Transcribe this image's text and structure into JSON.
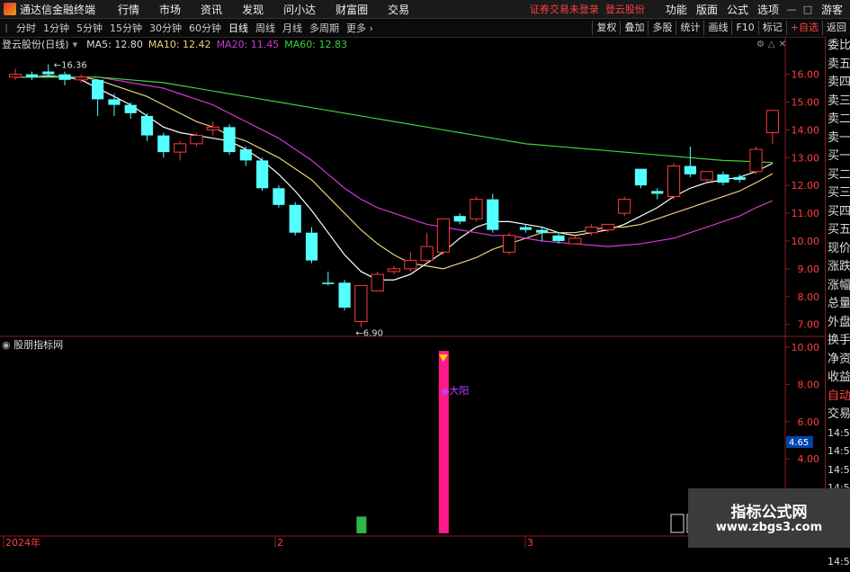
{
  "app": {
    "name": "通达信金融终端"
  },
  "menu": [
    "行情",
    "市场",
    "资讯",
    "发现",
    "问小达",
    "财富圈",
    "交易"
  ],
  "warning": "证券交易未登录",
  "warning_stock": "登云股份",
  "right_menu": [
    "功能",
    "版面",
    "公式",
    "选项"
  ],
  "guest": "游客",
  "periods": [
    "分时",
    "1分钟",
    "5分钟",
    "15分钟",
    "30分钟",
    "60分钟",
    "日线",
    "周线",
    "月线",
    "多周期",
    "更多"
  ],
  "active_period": "日线",
  "tools": [
    "复权",
    "叠加",
    "多股",
    "统计",
    "画线",
    "F10",
    "标记",
    "+自选",
    "返回"
  ],
  "chart_header": {
    "stock": "登云股份(日线)",
    "ma5": "MA5: 12.80",
    "ma10": "MA10: 12.42",
    "ma20": "MA20: 11.45",
    "ma60": "MA60: 12.83"
  },
  "price_axis": [
    "16.00",
    "15.00",
    "14.00",
    "13.00",
    "12.00",
    "11.00",
    "10.00",
    "9.00",
    "8.00",
    "7.00"
  ],
  "high_label": "16.36",
  "low_label": "6.90",
  "lower_panel": {
    "title": "股朋指标网",
    "axis": [
      "10.00",
      "8.00",
      "6.00",
      "4.00",
      "2.00"
    ],
    "marker_label": "大阳",
    "current_value": "4.65"
  },
  "date_axis": [
    "2024年",
    "2",
    "3"
  ],
  "right_panel": {
    "labels": [
      "委比",
      "卖五",
      "卖四",
      "卖三",
      "卖二",
      "卖一",
      "买一",
      "买二",
      "买三",
      "买四",
      "买五",
      "现价",
      "涨跌",
      "涨幅",
      "总量",
      "外盘",
      "换手",
      "净资",
      "收益",
      "自动",
      "交易"
    ],
    "times": [
      "14:55",
      "14:56",
      "14:56",
      "14:56",
      "14:56",
      "14:56",
      "14:56",
      "14:56"
    ]
  },
  "watermark": {
    "title": "指标公式网",
    "url": "www.zbgs3.com"
  },
  "colors": {
    "up": "#ff3a3a",
    "down": "#54ffff",
    "ma5": "#ffffff",
    "ma10": "#e8d27a",
    "ma20": "#d23ad2",
    "ma60": "#3ad23a",
    "marker": "#ff1a8c"
  },
  "chart_data": {
    "type": "candlestick",
    "candles": [
      {
        "o": 15.9,
        "c": 16.0,
        "h": 16.2,
        "l": 15.8
      },
      {
        "o": 16.0,
        "c": 15.9,
        "h": 16.1,
        "l": 15.8
      },
      {
        "o": 16.1,
        "c": 16.0,
        "h": 16.36,
        "l": 15.9
      },
      {
        "o": 16.0,
        "c": 15.8,
        "h": 16.1,
        "l": 15.6
      },
      {
        "o": 15.8,
        "c": 15.9,
        "h": 16.0,
        "l": 15.7
      },
      {
        "o": 15.8,
        "c": 15.1,
        "h": 15.8,
        "l": 14.5
      },
      {
        "o": 15.1,
        "c": 14.9,
        "h": 15.3,
        "l": 14.5
      },
      {
        "o": 14.9,
        "c": 14.6,
        "h": 15.0,
        "l": 14.4
      },
      {
        "o": 14.5,
        "c": 13.8,
        "h": 14.6,
        "l": 13.6
      },
      {
        "o": 13.8,
        "c": 13.2,
        "h": 13.9,
        "l": 13.0
      },
      {
        "o": 13.2,
        "c": 13.5,
        "h": 13.6,
        "l": 12.9
      },
      {
        "o": 13.5,
        "c": 13.8,
        "h": 13.9,
        "l": 13.4
      },
      {
        "o": 14.0,
        "c": 14.1,
        "h": 14.3,
        "l": 13.8
      },
      {
        "o": 14.1,
        "c": 13.2,
        "h": 14.2,
        "l": 13.1
      },
      {
        "o": 13.3,
        "c": 12.9,
        "h": 13.4,
        "l": 12.7
      },
      {
        "o": 12.9,
        "c": 11.9,
        "h": 13.0,
        "l": 11.8
      },
      {
        "o": 11.9,
        "c": 11.3,
        "h": 12.0,
        "l": 11.2
      },
      {
        "o": 11.3,
        "c": 10.3,
        "h": 11.4,
        "l": 10.2
      },
      {
        "o": 10.3,
        "c": 9.3,
        "h": 10.5,
        "l": 9.2
      },
      {
        "o": 8.5,
        "c": 8.45,
        "h": 8.9,
        "l": 8.4
      },
      {
        "o": 8.5,
        "c": 7.6,
        "h": 8.6,
        "l": 7.5
      },
      {
        "o": 7.1,
        "c": 8.4,
        "h": 8.4,
        "l": 6.9
      },
      {
        "o": 8.2,
        "c": 8.8,
        "h": 8.9,
        "l": 8.2
      },
      {
        "o": 8.9,
        "c": 9.0,
        "h": 9.1,
        "l": 8.8
      },
      {
        "o": 9.0,
        "c": 9.3,
        "h": 9.6,
        "l": 8.9
      },
      {
        "o": 9.3,
        "c": 9.8,
        "h": 10.3,
        "l": 9.2
      },
      {
        "o": 9.6,
        "c": 10.8,
        "h": 10.8,
        "l": 9.5
      },
      {
        "o": 10.9,
        "c": 10.7,
        "h": 11.0,
        "l": 10.6
      },
      {
        "o": 10.8,
        "c": 11.5,
        "h": 11.6,
        "l": 10.7
      },
      {
        "o": 11.5,
        "c": 10.4,
        "h": 11.7,
        "l": 10.3
      },
      {
        "o": 9.6,
        "c": 10.2,
        "h": 10.3,
        "l": 9.5
      },
      {
        "o": 10.5,
        "c": 10.4,
        "h": 10.6,
        "l": 10.3
      },
      {
        "o": 10.4,
        "c": 10.3,
        "h": 10.5,
        "l": 10.0
      },
      {
        "o": 10.2,
        "c": 10.0,
        "h": 10.3,
        "l": 9.9
      },
      {
        "o": 9.9,
        "c": 10.1,
        "h": 10.2,
        "l": 9.9
      },
      {
        "o": 10.3,
        "c": 10.5,
        "h": 10.6,
        "l": 10.2
      },
      {
        "o": 10.4,
        "c": 10.6,
        "h": 10.6,
        "l": 10.3
      },
      {
        "o": 11.0,
        "c": 11.5,
        "h": 11.6,
        "l": 10.9
      },
      {
        "o": 12.6,
        "c": 12.0,
        "h": 12.6,
        "l": 11.9
      },
      {
        "o": 11.8,
        "c": 11.7,
        "h": 11.9,
        "l": 11.5
      },
      {
        "o": 11.6,
        "c": 12.7,
        "h": 12.8,
        "l": 11.5
      },
      {
        "o": 12.7,
        "c": 12.4,
        "h": 13.4,
        "l": 12.3
      },
      {
        "o": 12.2,
        "c": 12.5,
        "h": 12.5,
        "l": 12.1
      },
      {
        "o": 12.4,
        "c": 12.1,
        "h": 12.5,
        "l": 12.0
      },
      {
        "o": 12.3,
        "c": 12.2,
        "h": 12.4,
        "l": 12.1
      },
      {
        "o": 12.5,
        "c": 13.3,
        "h": 13.4,
        "l": 12.4
      },
      {
        "o": 13.9,
        "c": 14.7,
        "h": 14.7,
        "l": 13.5
      }
    ],
    "ma_lines": [
      {
        "name": "MA5",
        "values": [
          15.9,
          15.9,
          15.95,
          15.9,
          15.8,
          15.5,
          15.2,
          14.9,
          14.5,
          14.1,
          13.9,
          13.8,
          13.7,
          13.6,
          13.3,
          12.9,
          12.4,
          11.8,
          11.1,
          10.3,
          9.5,
          8.9,
          8.6,
          8.6,
          8.8,
          9.2,
          9.6,
          10.1,
          10.5,
          10.7,
          10.7,
          10.6,
          10.5,
          10.3,
          10.2,
          10.3,
          10.4,
          10.6,
          10.9,
          11.2,
          11.6,
          11.9,
          12.1,
          12.2,
          12.3,
          12.5,
          12.8
        ]
      },
      {
        "name": "MA10",
        "values": [
          15.9,
          15.9,
          15.9,
          15.9,
          15.9,
          15.8,
          15.6,
          15.4,
          15.2,
          14.9,
          14.6,
          14.3,
          14.1,
          13.8,
          13.6,
          13.3,
          13.0,
          12.6,
          12.2,
          11.6,
          11.0,
          10.4,
          9.9,
          9.5,
          9.2,
          9.1,
          9.0,
          9.2,
          9.4,
          9.7,
          9.9,
          10.1,
          10.3,
          10.3,
          10.3,
          10.4,
          10.5,
          10.5,
          10.6,
          10.8,
          11.0,
          11.2,
          11.4,
          11.6,
          11.8,
          12.1,
          12.42
        ]
      },
      {
        "name": "MA20",
        "values": [
          15.9,
          15.9,
          15.9,
          15.9,
          15.9,
          15.9,
          15.8,
          15.7,
          15.6,
          15.5,
          15.3,
          15.1,
          14.9,
          14.6,
          14.3,
          14.0,
          13.7,
          13.3,
          12.9,
          12.4,
          11.9,
          11.5,
          11.2,
          11.0,
          10.8,
          10.6,
          10.5,
          10.4,
          10.3,
          10.2,
          10.2,
          10.1,
          10.0,
          9.95,
          9.9,
          9.85,
          9.8,
          9.85,
          9.9,
          10.0,
          10.1,
          10.3,
          10.5,
          10.7,
          10.9,
          11.2,
          11.45
        ]
      },
      {
        "name": "MA60",
        "values": [
          15.9,
          15.9,
          15.9,
          15.9,
          15.9,
          15.9,
          15.85,
          15.8,
          15.75,
          15.7,
          15.6,
          15.5,
          15.4,
          15.3,
          15.2,
          15.1,
          15.0,
          14.9,
          14.8,
          14.7,
          14.6,
          14.5,
          14.4,
          14.3,
          14.2,
          14.1,
          14.0,
          13.9,
          13.8,
          13.7,
          13.6,
          13.5,
          13.45,
          13.4,
          13.35,
          13.3,
          13.25,
          13.2,
          13.15,
          13.1,
          13.05,
          13.0,
          12.95,
          12.9,
          12.88,
          12.85,
          12.83
        ]
      }
    ],
    "lower_bars": [
      {
        "index": 21,
        "value": 0.9,
        "color": "#2db84a"
      },
      {
        "index": 26,
        "value": 9.8,
        "color": "#ff1a8c"
      }
    ],
    "ylim": [
      6.6,
      16.7
    ]
  }
}
